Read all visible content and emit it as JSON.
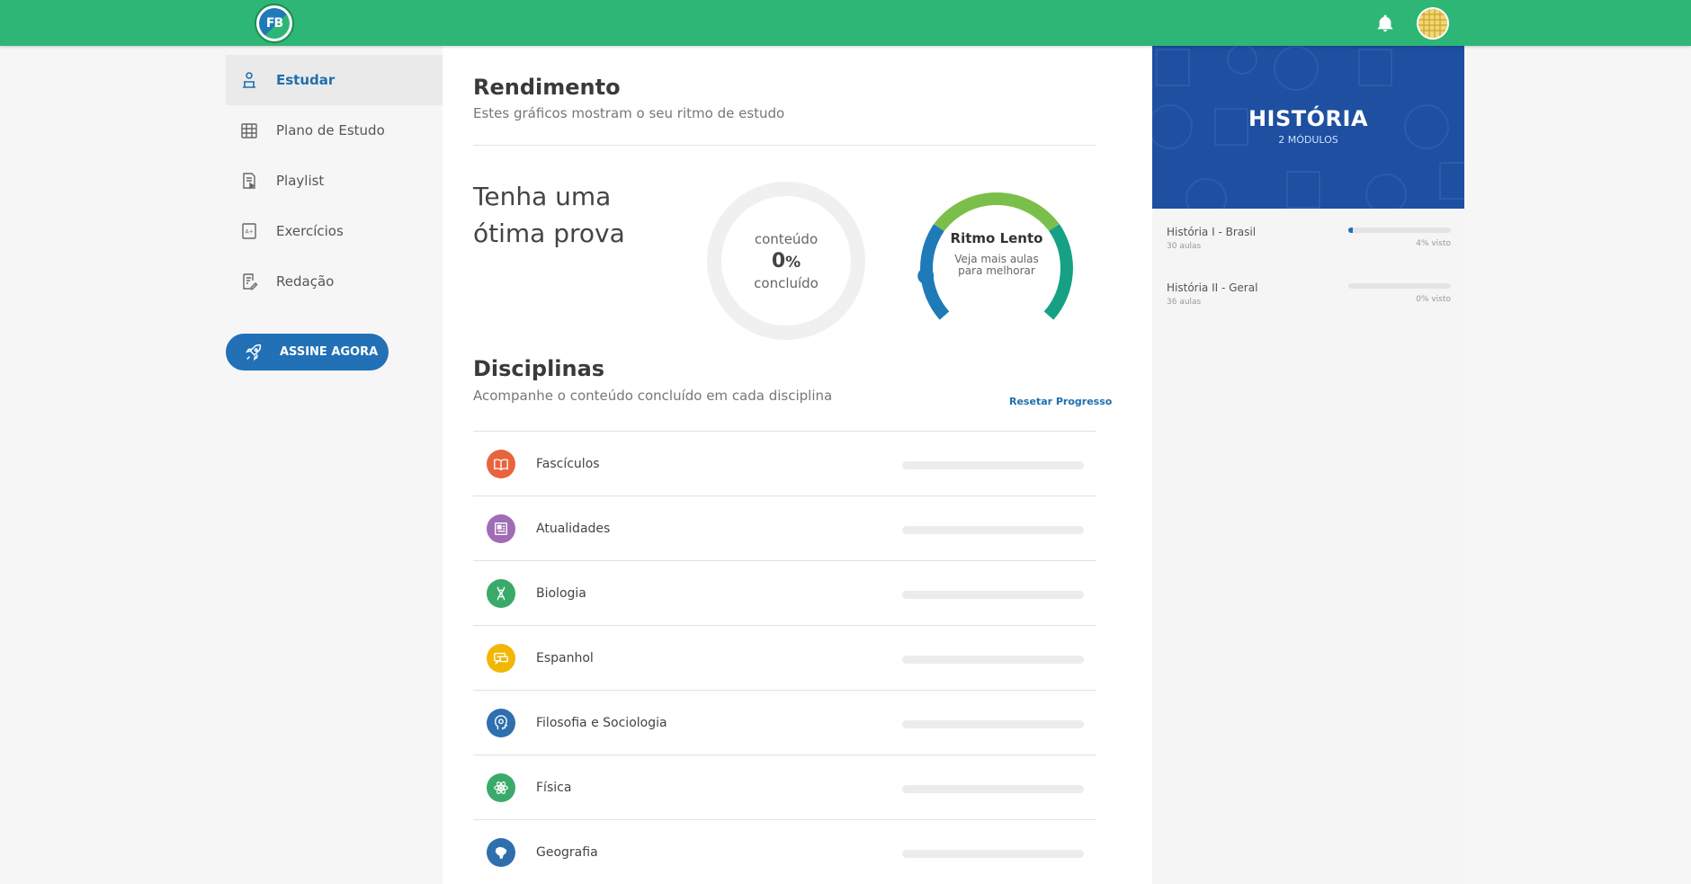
{
  "topbar": {
    "logo_text": "FB",
    "icons": {
      "notifications": "bell-icon",
      "profile": "avatar"
    }
  },
  "sidebar": {
    "items": [
      {
        "label": "Estudar",
        "icon": "study-desk-icon",
        "active": true
      },
      {
        "label": "Plano de Estudo",
        "icon": "calendar-grid-icon",
        "active": false
      },
      {
        "label": "Playlist",
        "icon": "playlist-document-icon",
        "active": false
      },
      {
        "label": "Exercícios",
        "icon": "exercise-aplus-icon",
        "active": false
      },
      {
        "label": "Redação",
        "icon": "essay-pencil-icon",
        "active": false
      }
    ],
    "cta_label": "ASSINE AGORA"
  },
  "rendimento": {
    "title": "Rendimento",
    "subtitle": "Estes gráficos mostram o seu ritmo de estudo",
    "goal_line1": "Tenha uma",
    "goal_line2": "ótima prova",
    "donut": {
      "label_top": "conteúdo",
      "value": "0",
      "unit": "%",
      "label_bottom": "concluído",
      "fraction": 0
    },
    "gauge": {
      "title": "Ritmo Lento",
      "line1": "Veja mais aulas",
      "line2": "para melhorar",
      "level": 0
    }
  },
  "disciplinas": {
    "title": "Disciplinas",
    "subtitle": "Acompanhe o conteúdo concluído em cada disciplina",
    "reset_label": "Resetar Progresso",
    "rows": [
      {
        "name": "Fascículos",
        "icon": "book-icon",
        "color": "#e8643c",
        "progress": 0
      },
      {
        "name": "Atualidades",
        "icon": "newspaper-icon",
        "color": "#a06cb5",
        "progress": 0
      },
      {
        "name": "Biologia",
        "icon": "dna-icon",
        "color": "#3aaa6a",
        "progress": 0
      },
      {
        "name": "Espanhol",
        "icon": "speech-bubble-icon",
        "color": "#f2b705",
        "progress": 0
      },
      {
        "name": "Filosofia e Sociologia",
        "icon": "head-gear-icon",
        "color": "#2f6fae",
        "progress": 0
      },
      {
        "name": "Física",
        "icon": "atom-icon",
        "color": "#3aaa6a",
        "progress": 0
      },
      {
        "name": "Geografia",
        "icon": "brazil-map-icon",
        "color": "#2f6fae",
        "progress": 0
      }
    ]
  },
  "subject_panel": {
    "title": "HISTÓRIA",
    "subtitle": "2 MÓDULOS",
    "modules": [
      {
        "name": "História I - Brasil",
        "count": "30 aulas",
        "seen": "4% visto",
        "progress": 0.04
      },
      {
        "name": "História II - Geral",
        "count": "36 aulas",
        "seen": "0% visto",
        "progress": 0
      }
    ]
  },
  "colors": {
    "topbar": "#2db676",
    "accent_blue": "#2270b5",
    "hero_blue": "#1e4fa0",
    "gauge_green": "#7bbf4a",
    "gauge_teal": "#16a184",
    "gauge_blue": "#1f7ab8"
  }
}
